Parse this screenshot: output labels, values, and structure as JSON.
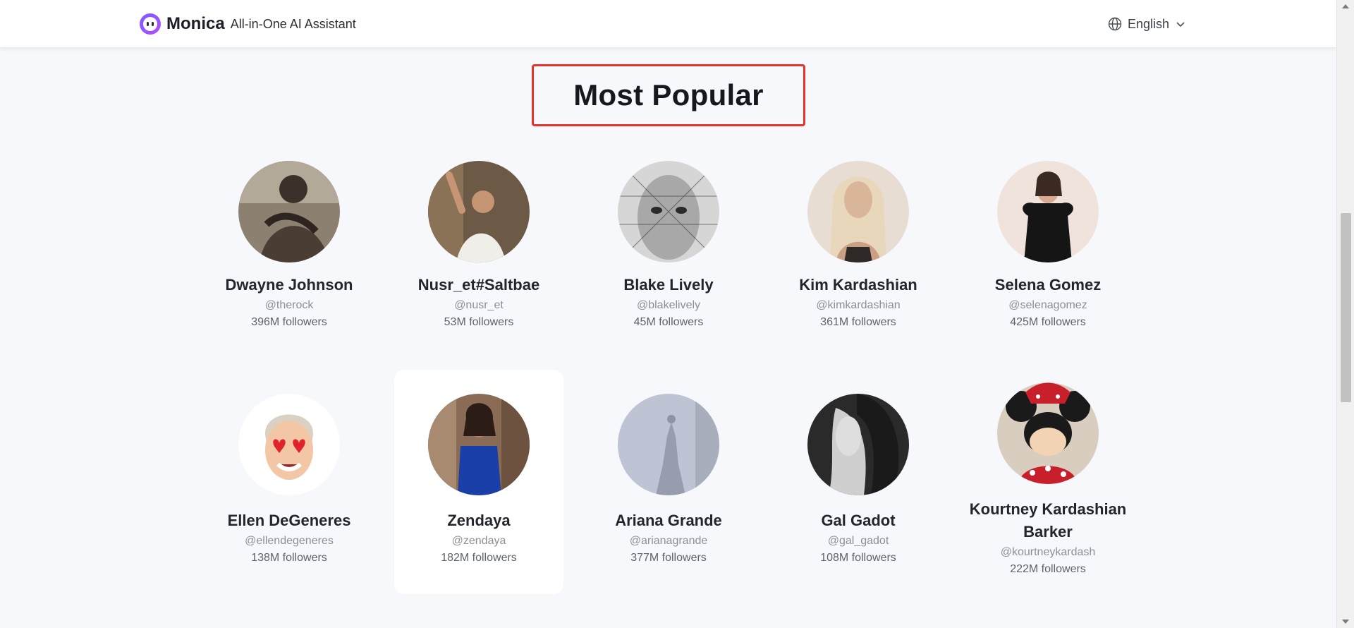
{
  "header": {
    "brand": "Monica",
    "tagline": "All-in-One AI Assistant",
    "language": "English"
  },
  "section": {
    "title": "Most Popular"
  },
  "profiles": [
    {
      "name": "Dwayne Johnson",
      "handle": "@therock",
      "followers": "396M followers"
    },
    {
      "name": "Nusr_et#Saltbae",
      "handle": "@nusr_et",
      "followers": "53M followers"
    },
    {
      "name": "Blake Lively",
      "handle": "@blakelively",
      "followers": "45M followers"
    },
    {
      "name": "Kim Kardashian",
      "handle": "@kimkardashian",
      "followers": "361M followers"
    },
    {
      "name": "Selena Gomez",
      "handle": "@selenagomez",
      "followers": "425M followers"
    },
    {
      "name": "Ellen DeGeneres",
      "handle": "@ellendegeneres",
      "followers": "138M followers"
    },
    {
      "name": "Zendaya",
      "handle": "@zendaya",
      "followers": "182M followers"
    },
    {
      "name": "Ariana Grande",
      "handle": "@arianagrande",
      "followers": "377M followers"
    },
    {
      "name": "Gal Gadot",
      "handle": "@gal_gadot",
      "followers": "108M followers"
    },
    {
      "name": "Kourtney Kardashian Barker",
      "name_line1": "Kourtney Kardashian",
      "name_line2": "Barker",
      "handle": "@kourtneykardash",
      "followers": "222M followers"
    }
  ],
  "colors": {
    "accent": "#7b5cff",
    "highlight_border": "#e8332a",
    "page_bg": "#f6f8fb"
  }
}
